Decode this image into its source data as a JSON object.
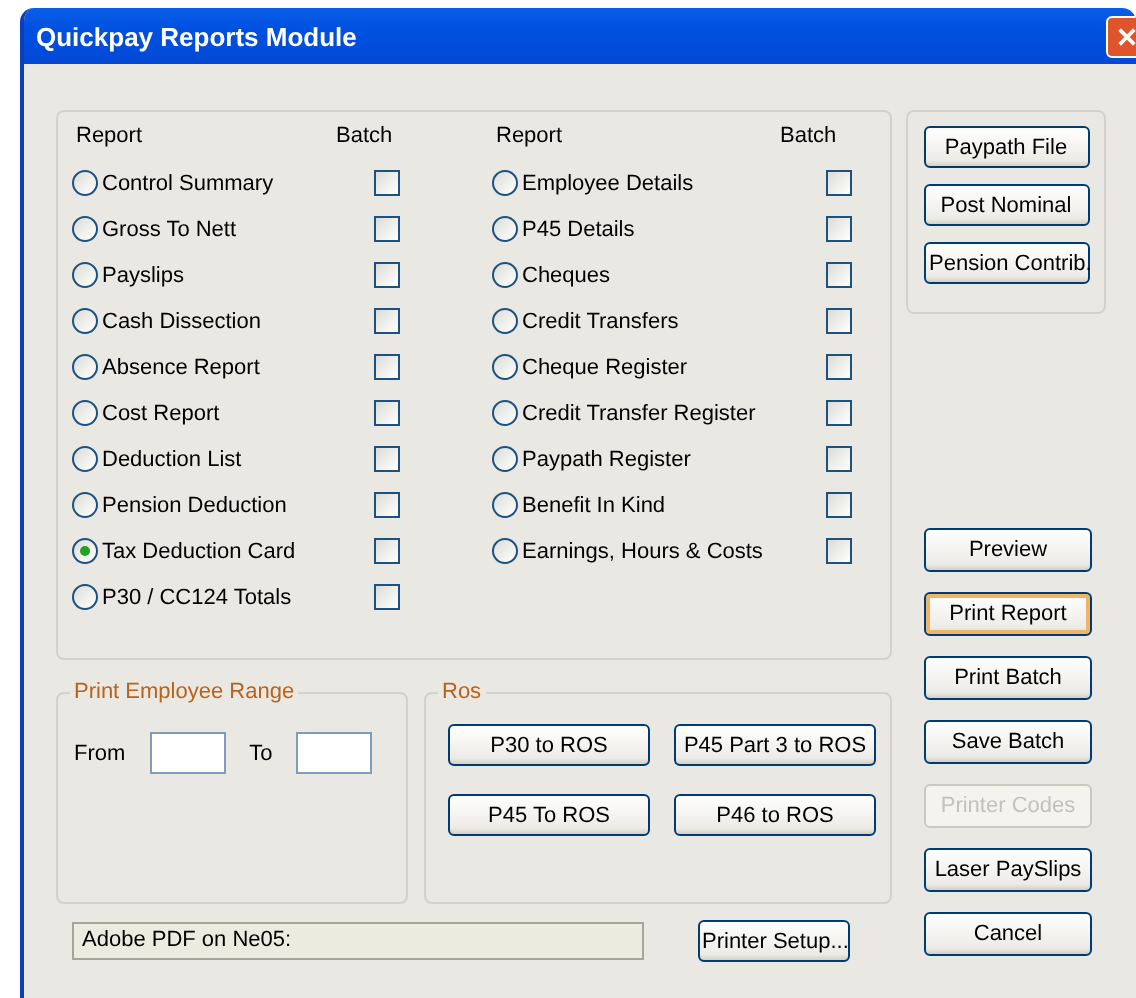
{
  "window": {
    "title": "Quickpay Reports Module"
  },
  "report_columns": [
    {
      "report_heading": "Report",
      "batch_heading": "Batch",
      "items": [
        {
          "label": "Control Summary",
          "selected": false,
          "batch": false
        },
        {
          "label": "Gross To Nett",
          "selected": false,
          "batch": false
        },
        {
          "label": "Payslips",
          "selected": false,
          "batch": false
        },
        {
          "label": "Cash Dissection",
          "selected": false,
          "batch": false
        },
        {
          "label": "Absence Report",
          "selected": false,
          "batch": false
        },
        {
          "label": "Cost Report",
          "selected": false,
          "batch": false
        },
        {
          "label": "Deduction List",
          "selected": false,
          "batch": false
        },
        {
          "label": "Pension Deduction",
          "selected": false,
          "batch": false
        },
        {
          "label": "Tax Deduction Card",
          "selected": true,
          "batch": false
        },
        {
          "label": "P30 / CC124 Totals",
          "selected": false,
          "batch": false
        }
      ]
    },
    {
      "report_heading": "Report",
      "batch_heading": "Batch",
      "items": [
        {
          "label": "Employee Details",
          "selected": false,
          "batch": false
        },
        {
          "label": "P45 Details",
          "selected": false,
          "batch": false
        },
        {
          "label": "Cheques",
          "selected": false,
          "batch": false
        },
        {
          "label": "Credit Transfers",
          "selected": false,
          "batch": false
        },
        {
          "label": "Cheque Register",
          "selected": false,
          "batch": false
        },
        {
          "label": "Credit Transfer Register",
          "selected": false,
          "batch": false
        },
        {
          "label": "Paypath Register",
          "selected": false,
          "batch": false
        },
        {
          "label": "Benefit In Kind",
          "selected": false,
          "batch": false
        },
        {
          "label": "Earnings, Hours & Costs",
          "selected": false,
          "batch": false
        }
      ]
    }
  ],
  "export_buttons": [
    {
      "label": "Paypath File"
    },
    {
      "label": "Post Nominal"
    },
    {
      "label": "Pension Contrib."
    }
  ],
  "employee_range": {
    "title": "Print Employee Range",
    "from_label": "From",
    "to_label": "To"
  },
  "ros": {
    "title": "Ros",
    "buttons": [
      {
        "label": "P30 to ROS"
      },
      {
        "label": "P45 Part 3 to ROS"
      },
      {
        "label": "P45 To ROS"
      },
      {
        "label": "P46 to ROS"
      }
    ]
  },
  "printer": {
    "name": "Adobe PDF on Ne05:",
    "setup_button": "Printer Setup..."
  },
  "action_buttons": [
    {
      "label": "Preview",
      "focused": false,
      "disabled": false
    },
    {
      "label": "Print Report",
      "focused": true,
      "disabled": false
    },
    {
      "label": "Print Batch",
      "focused": false,
      "disabled": false
    },
    {
      "label": "Save Batch",
      "focused": false,
      "disabled": false
    },
    {
      "label": "Printer Codes",
      "focused": false,
      "disabled": true
    },
    {
      "label": "Laser PaySlips",
      "focused": false,
      "disabled": false
    },
    {
      "label": "Cancel",
      "focused": false,
      "disabled": false
    }
  ]
}
